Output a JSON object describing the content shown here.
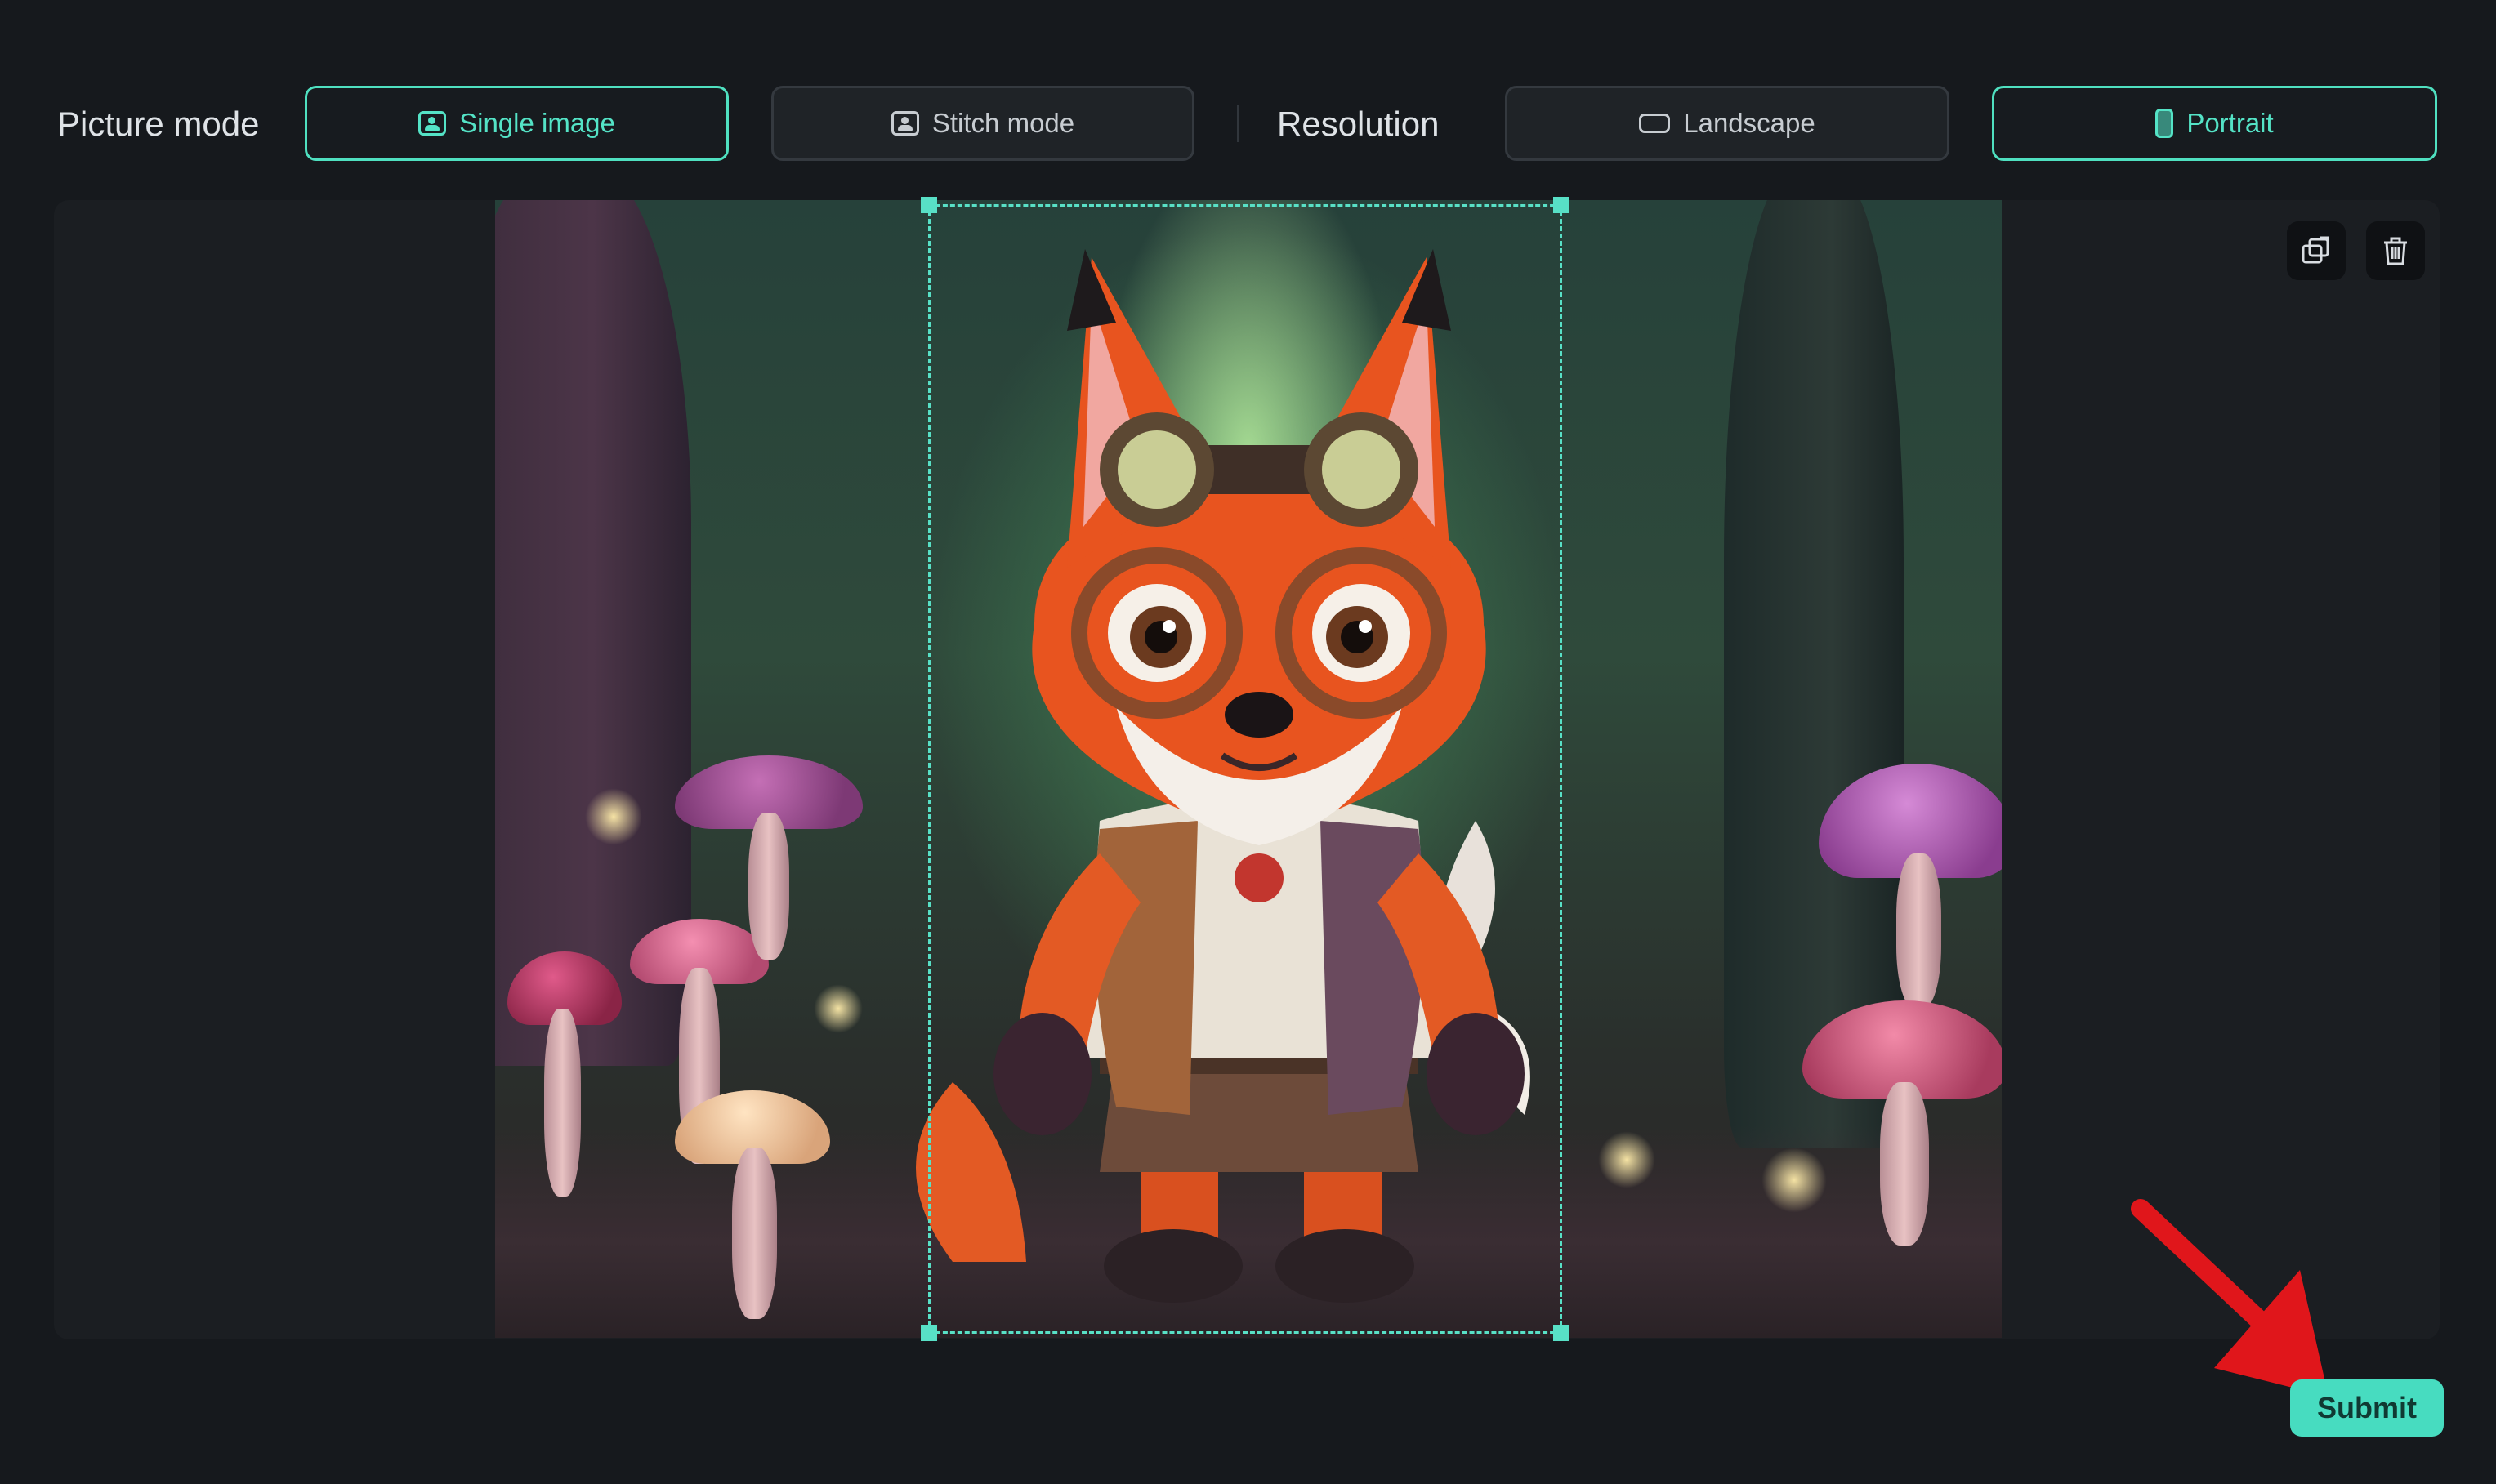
{
  "toolbar": {
    "picture_mode_label": "Picture mode",
    "single_image_label": "Single image",
    "stitch_mode_label": "Stitch mode",
    "resolution_label": "Resolution",
    "landscape_label": "Landscape",
    "portrait_label": "Portrait"
  },
  "state": {
    "picture_mode": "Single image",
    "resolution": "Portrait"
  },
  "canvas": {
    "image_subject": "cartoon fox with goggles in a mushroom forest",
    "tools": [
      "replace-icon",
      "trash-icon"
    ]
  },
  "footer": {
    "submit_label": "Submit"
  },
  "colors": {
    "accent": "#4fe0c0",
    "background": "#16191d",
    "annotation_arrow": "#e0161b"
  }
}
